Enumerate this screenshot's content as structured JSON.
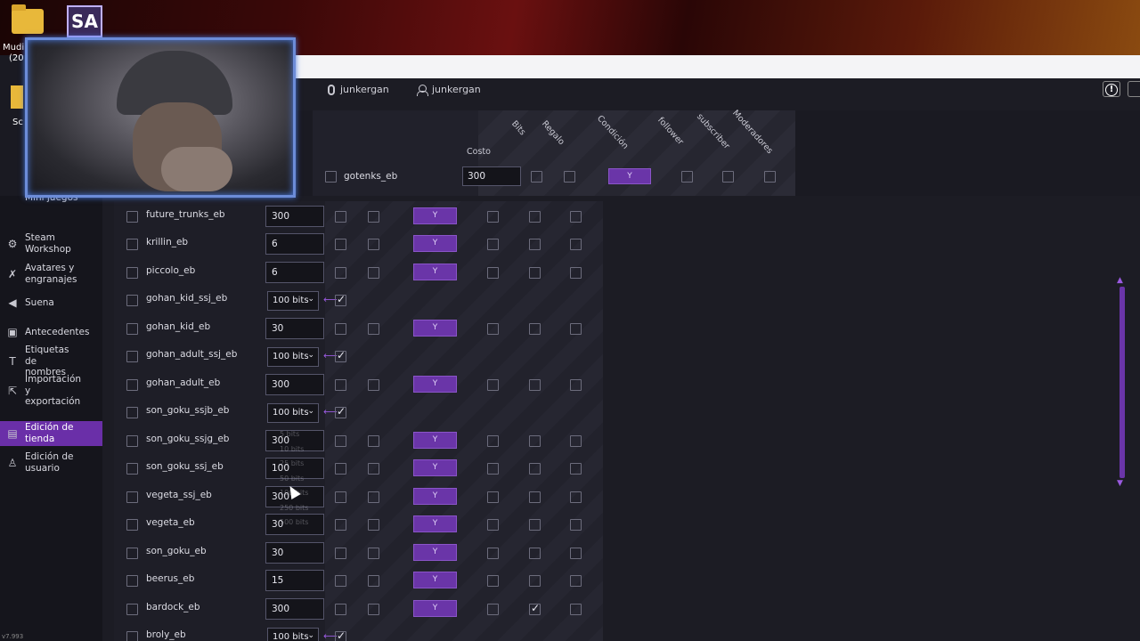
{
  "desktop": {
    "label_1": "Mudi",
    "label_2": "(20",
    "label_3": "Sc",
    "sa_icon_text": "SA"
  },
  "topbar": {
    "user_1": "junkergan",
    "user_2": "junkergan",
    "alert_symbol": "!"
  },
  "sidebar": {
    "items": [
      {
        "label": "Mini juegos",
        "icon": "gamepad-icon"
      },
      {
        "label": "Steam Workshop",
        "icon": "steam-icon"
      },
      {
        "label": "Avatares y engranajes",
        "icon": "avatar-icon"
      },
      {
        "label": "Suena",
        "icon": "speaker-icon"
      },
      {
        "label": "Antecedentes",
        "icon": "image-icon"
      },
      {
        "label": "Etiquetas de nombres",
        "icon": "text-icon"
      },
      {
        "label": "Importación y exportación",
        "icon": "export-icon"
      },
      {
        "label": "Edición de tienda",
        "icon": "shop-icon"
      },
      {
        "label": "Edición de usuario",
        "icon": "user-edit-icon"
      }
    ],
    "version": "v7.993"
  },
  "header": {
    "costo": "Costo",
    "bits": "Bits",
    "regalo": "Regalo",
    "condicion": "Condición",
    "follower": "follower",
    "subscriber": "subscriber",
    "moderadores": "Moderadores",
    "first_row": {
      "name": "gotenks_eb",
      "cost": "300",
      "cond": "Y"
    }
  },
  "rows": [
    {
      "name": "future_trunks_eb",
      "cost": "300",
      "type": "input",
      "cond": "Y",
      "cb_sub": false
    },
    {
      "name": "krillin_eb",
      "cost": "6",
      "type": "input",
      "cond": "Y",
      "cb_sub": false
    },
    {
      "name": "piccolo_eb",
      "cost": "6",
      "type": "input",
      "cond": "Y",
      "cb_sub": false
    },
    {
      "name": "gohan_kid_ssj_eb",
      "cost": "100 bits",
      "type": "select",
      "cond": "",
      "cb_sub": false
    },
    {
      "name": "gohan_kid_eb",
      "cost": "30",
      "type": "input",
      "cond": "Y",
      "cb_sub": false
    },
    {
      "name": "gohan_adult_ssj_eb",
      "cost": "100 bits",
      "type": "select",
      "cond": "",
      "cb_sub": false
    },
    {
      "name": "gohan_adult_eb",
      "cost": "300",
      "type": "input",
      "cond": "Y",
      "cb_sub": false
    },
    {
      "name": "son_goku_ssjb_eb",
      "cost": "100 bits",
      "type": "select",
      "cond": "",
      "cb_sub": false
    },
    {
      "name": "son_goku_ssjg_eb",
      "cost": "300",
      "type": "input",
      "cond": "Y",
      "cb_sub": false
    },
    {
      "name": "son_goku_ssj_eb",
      "cost": "100",
      "type": "input",
      "cond": "Y",
      "cb_sub": false
    },
    {
      "name": "vegeta_ssj_eb",
      "cost": "300",
      "type": "input",
      "cond": "Y",
      "cb_sub": false
    },
    {
      "name": "vegeta_eb",
      "cost": "30",
      "type": "input",
      "cond": "Y",
      "cb_sub": false
    },
    {
      "name": "son_goku_eb",
      "cost": "30",
      "type": "input",
      "cond": "Y",
      "cb_sub": false
    },
    {
      "name": "beerus_eb",
      "cost": "15",
      "type": "input",
      "cond": "Y",
      "cb_sub": false
    },
    {
      "name": "bardock_eb",
      "cost": "300",
      "type": "input",
      "cond": "Y",
      "cb_sub": true
    },
    {
      "name": "broly_eb",
      "cost": "100 bits",
      "type": "select",
      "cond": "",
      "cb_sub": false
    }
  ],
  "ghost_options": [
    "5 bits",
    "10 bits",
    "25 bits",
    "50 bits",
    "100 bits",
    "250 bits",
    "500 bits"
  ]
}
